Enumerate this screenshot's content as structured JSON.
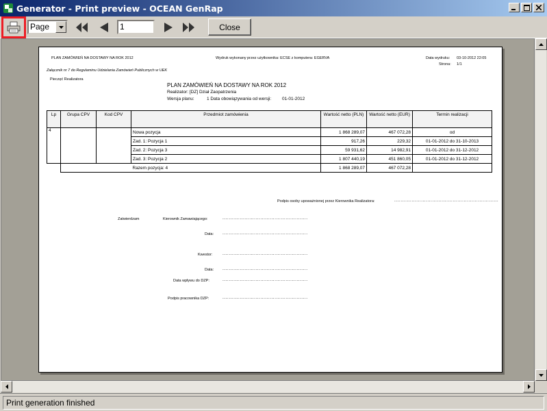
{
  "window": {
    "title": "Generator  - Print preview - OCEAN GenRap",
    "controls": [
      "minimize",
      "maximize",
      "close"
    ]
  },
  "toolbar": {
    "zoom_value": "Page",
    "page_number": "1",
    "close_label": "Close"
  },
  "status": {
    "text": "Print generation finished"
  },
  "document": {
    "header_left": "PLAN ZAMÓWIEŃ NA DOSTAWY NA ROK 2012",
    "header_center": "Wydruk wykonany przez użytkownika: ECSE z komputera: EGERVA",
    "header_date_label": "Data wydruku:",
    "header_date": "03-10-2012 22:05",
    "header_page_label": "Strona:",
    "header_page": "1/1",
    "attachment_note": "Załącznik nr 7 do Regulaminu Udzielania Zamówień Publicznych w UEK",
    "stamp_label": "Pieczęć Realizatora",
    "main_title": "PLAN ZAMÓWIEŃ NA DOSTAWY NA ROK 2012",
    "realizator": "Realizator: [DZ] Dział Zaopatrzenia",
    "version_label": "Wersja planu:",
    "version_value": "1  Data obowiązywania od wersji:",
    "version_date": "01-01-2012",
    "table": {
      "headers": [
        "Lp",
        "Grupa CPV",
        "Kod CPV",
        "Przedmiot zamówienia",
        "Wartość netto (PLN)",
        "Wartość netto (EUR)",
        "Termin realizacji"
      ],
      "lp": "4",
      "rows": [
        {
          "item": "Nowa pozycja",
          "pln": "1 868 289,07",
          "eur": "467 072,28",
          "term": "od"
        },
        {
          "item": "Zad. 1: Pozycja 1",
          "pln": "917,26",
          "eur": "229,32",
          "term": "01-01-2012 do 31-10-2013"
        },
        {
          "item": "Zad. 2: Pozycja 3",
          "pln": "59 931,62",
          "eur": "14 982,91",
          "term": "01-01-2012 do 31-12-2012"
        },
        {
          "item": "Zad. 3: Pozycja 2",
          "pln": "1 807 440,19",
          "eur": "451 860,05",
          "term": "01-01-2012 do 31-12-2012"
        }
      ],
      "total": {
        "item": "Razem pozycja: 4",
        "pln": "1 868 289,07",
        "eur": "467 072,28"
      }
    },
    "signature_label": "Podpis osoby upoważnionej przez Kierownika Realizatora:",
    "approve_label": "Zatwierdzam",
    "manager_label": "Kierownik Zamawiającego:",
    "date_label_1": "Data:",
    "quaestor_label": "Kwestor:",
    "date_label_2": "Data:",
    "receipt_label": "Data wpływu do DZP:",
    "employee_label": "Podpis pracownika DZP:",
    "dots_long": "..................................................................",
    "dots": "......................................................"
  }
}
